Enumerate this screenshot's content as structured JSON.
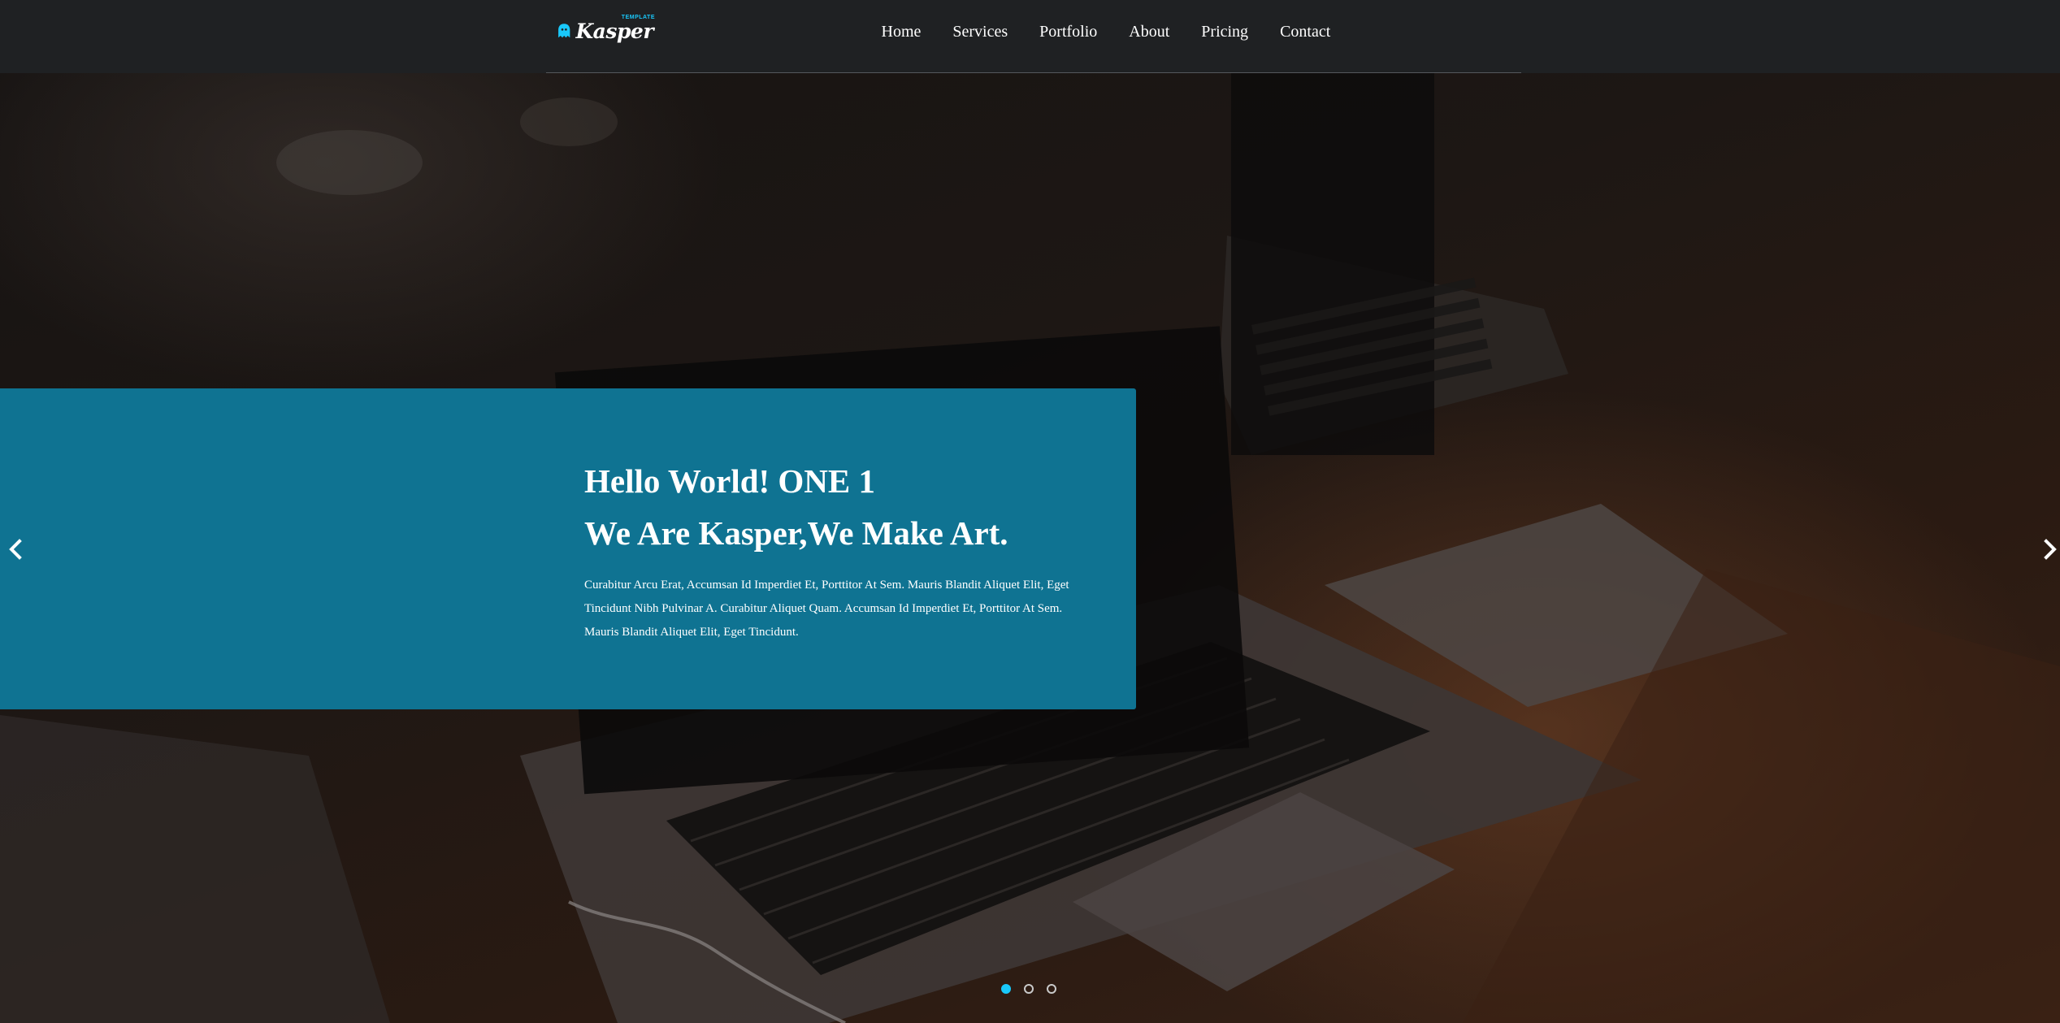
{
  "header": {
    "logo": {
      "name": "Kasper",
      "sub": "TEMPLATE"
    },
    "nav": [
      "Home",
      "Services",
      "Portfolio",
      "About",
      "Pricing",
      "Contact"
    ]
  },
  "slide": {
    "headline_line1": "Hello World! ONE 1",
    "headline_line2": "We Are Kasper,We Make Art.",
    "description": "Curabitur Arcu Erat, Accumsan Id Imperdiet Et, Porttitor At Sem. Mauris Blandit Aliquet Elit, Eget Tincidunt Nibh Pulvinar A. Curabitur Aliquet Quam. Accumsan Id Imperdiet Et, Porttitor At Sem. Mauris Blandit Aliquet Elit, Eget Tincidunt."
  },
  "carousel": {
    "active_index": 0,
    "slide_count": 3,
    "prev_icon": "chevron-left-icon",
    "next_icon": "chevron-right-icon"
  },
  "colors": {
    "accent": "#19c8fa",
    "panel": "#0f7392",
    "header_bg": "#1f2123"
  }
}
